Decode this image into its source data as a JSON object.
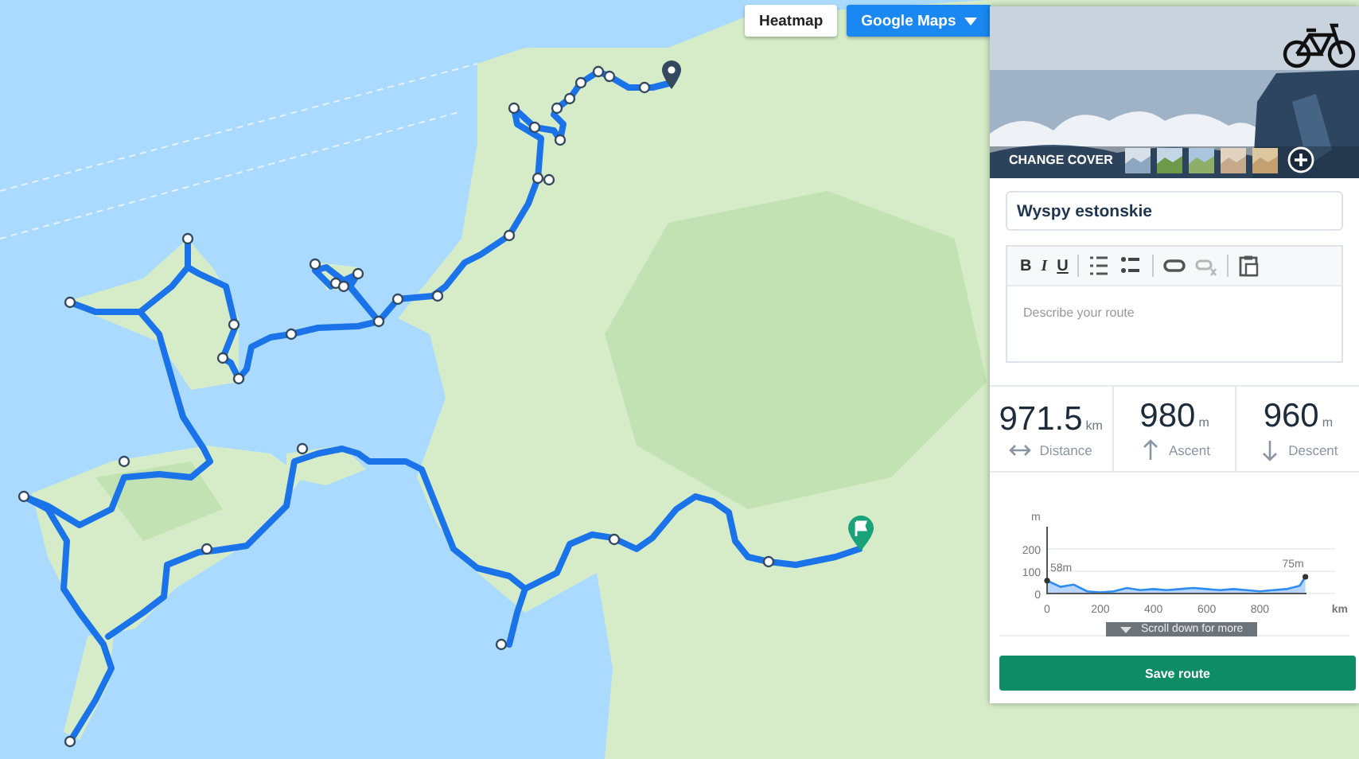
{
  "map_buttons": [
    {
      "label": "Heatmap",
      "kind": "plain",
      "caret": false
    },
    {
      "label": "Google Maps",
      "kind": "primary",
      "caret": true
    }
  ],
  "route_panel": {
    "cover": {
      "kind": "picture",
      "change_label": "CHANGE COVER"
    },
    "title_value": "Wyspy estonskie",
    "toolbar": [
      {
        "kind": "bold",
        "label": "B",
        "disabled": false
      },
      {
        "kind": "italic",
        "label": "I",
        "disabled": false
      },
      {
        "kind": "underline",
        "label": "U",
        "disabled": false
      },
      {
        "kind": "separator"
      },
      {
        "kind": "ordered-list",
        "disabled": false
      },
      {
        "kind": "bullet-list",
        "disabled": false
      },
      {
        "kind": "separator"
      },
      {
        "kind": "link",
        "disabled": false
      },
      {
        "kind": "unlink",
        "disabled": true
      },
      {
        "kind": "separator"
      },
      {
        "kind": "paste",
        "disabled": false
      }
    ],
    "description_placeholder": "Describe your route",
    "stats": [
      {
        "kind": "distance",
        "value": "971.5",
        "unit": "km",
        "label": "Distance"
      },
      {
        "kind": "ascent",
        "value": "980",
        "unit": "m",
        "label": "Ascent"
      },
      {
        "kind": "descent",
        "value": "960",
        "unit": "m",
        "label": "Descent"
      }
    ],
    "elevation": {
      "start_label": "58m",
      "end_label": "75m",
      "chart_data": {
        "type": "area",
        "xlabel": "km",
        "ylabel": "m",
        "ylim": [
          0,
          300
        ],
        "xlim": [
          0,
          975
        ],
        "yticks": [
          0,
          100,
          200
        ],
        "xticks": [
          0,
          200,
          400,
          600,
          800
        ],
        "x": [
          0,
          50,
          100,
          150,
          200,
          250,
          300,
          350,
          400,
          450,
          500,
          550,
          600,
          650,
          700,
          750,
          800,
          850,
          900,
          950,
          971
        ],
        "series": [
          {
            "color": "#2d8cf0",
            "values": [
              58,
              30,
              40,
              10,
              5,
              10,
              25,
              15,
              20,
              15,
              20,
              25,
              20,
              15,
              20,
              15,
              10,
              15,
              20,
              35,
              75
            ]
          }
        ]
      }
    },
    "scroll_hint": "Scroll down for more",
    "save_label": "Save route"
  }
}
